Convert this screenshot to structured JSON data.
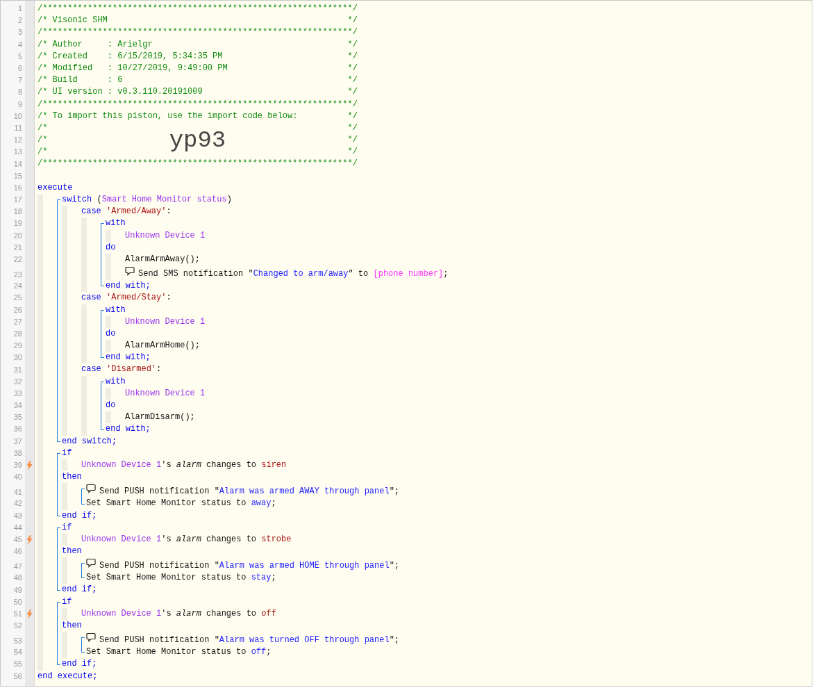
{
  "listing": [
    {
      "kind": "line",
      "number": "1",
      "tokens": [
        {
          "kind": "comment",
          "text": "/**************************************************************/"
        }
      ]
    },
    {
      "kind": "box",
      "number": "2",
      "tokens": [
        {
          "kind": "comment",
          "text": "/* Visonic SHM"
        },
        {
          "kind": "comment",
          "text": "*/"
        }
      ]
    },
    {
      "kind": "line",
      "number": "3",
      "tokens": [
        {
          "kind": "comment",
          "text": "/**************************************************************/"
        }
      ]
    },
    {
      "kind": "box",
      "number": "4",
      "tokens": [
        {
          "kind": "comment",
          "text": "/* Author     : Arielgr"
        },
        {
          "kind": "comment",
          "text": "*/"
        }
      ]
    },
    {
      "kind": "box",
      "number": "5",
      "tokens": [
        {
          "kind": "comment",
          "text": "/* Created    : 6/15/2019, 5:34:35 PM"
        },
        {
          "kind": "comment",
          "text": "*/"
        }
      ]
    },
    {
      "kind": "box",
      "number": "6",
      "tokens": [
        {
          "kind": "comment",
          "text": "/* Modified   : 10/27/2019, 9:49:00 PM"
        },
        {
          "kind": "comment",
          "text": "*/"
        }
      ]
    },
    {
      "kind": "box",
      "number": "7",
      "tokens": [
        {
          "kind": "comment",
          "text": "/* Build      : 6"
        },
        {
          "kind": "comment",
          "text": "*/"
        }
      ]
    },
    {
      "kind": "box",
      "number": "8",
      "tokens": [
        {
          "kind": "comment",
          "text": "/* UI version : v0.3.110.20191009"
        },
        {
          "kind": "comment",
          "text": "*/"
        }
      ]
    },
    {
      "kind": "line",
      "number": "9",
      "tokens": [
        {
          "kind": "comment",
          "text": "/**************************************************************/"
        }
      ]
    },
    {
      "kind": "box",
      "number": "10",
      "tokens": [
        {
          "kind": "comment",
          "text": "/* To import this piston, use the import code below:"
        },
        {
          "kind": "comment",
          "text": "*/"
        }
      ]
    },
    {
      "kind": "box",
      "number": "11",
      "tokens": [
        {
          "kind": "comment",
          "text": "/*"
        },
        {
          "kind": "comment",
          "text": "*/"
        }
      ]
    },
    {
      "kind": "box",
      "number": "12",
      "tokens": [
        {
          "kind": "comment",
          "text": "/*"
        },
        {
          "kind": "big",
          "text": "yp93"
        },
        {
          "kind": "comment",
          "text": "*/"
        }
      ]
    },
    {
      "kind": "box",
      "number": "13",
      "tokens": [
        {
          "kind": "comment",
          "text": "/*"
        },
        {
          "kind": "comment",
          "text": "*/"
        }
      ]
    },
    {
      "kind": "line",
      "number": "14",
      "tokens": [
        {
          "kind": "comment",
          "text": "/**************************************************************/"
        }
      ]
    },
    {
      "kind": "line",
      "number": "15"
    },
    {
      "kind": "line",
      "number": "16",
      "tokens": [
        {
          "kind": "kw",
          "text": "execute"
        }
      ],
      "children": [
        {
          "kind": "statement",
          "lines": [
            {
              "kind": "line",
              "number": "17",
              "tokens": [
                {
                  "kind": "kw",
                  "text": "switch"
                },
                {
                  "kind": "text",
                  "text": " ("
                },
                {
                  "kind": "dev",
                  "text": "Smart Home Monitor status"
                },
                {
                  "kind": "text",
                  "text": ")"
                }
              ],
              "children": [
                {
                  "kind": "line",
                  "number": "18",
                  "tokens": [
                    {
                      "kind": "kw",
                      "text": "case "
                    },
                    {
                      "kind": "str",
                      "text": "'Armed/Away'"
                    },
                    {
                      "kind": "text",
                      "text": ":"
                    }
                  ],
                  "children": [
                    {
                      "kind": "statement",
                      "lines": [
                        {
                          "kind": "line",
                          "number": "19",
                          "tokens": [
                            {
                              "kind": "kw",
                              "text": "with"
                            }
                          ],
                          "children": [
                            {
                              "kind": "line",
                              "number": "20",
                              "tokens": [
                                {
                                  "kind": "dev",
                                  "text": "Unknown Device 1"
                                }
                              ]
                            }
                          ]
                        },
                        {
                          "kind": "line",
                          "number": "21",
                          "tokens": [
                            {
                              "kind": "kw",
                              "text": "do"
                            }
                          ],
                          "children": [
                            {
                              "kind": "line",
                              "number": "22",
                              "tokens": [
                                {
                                  "kind": "text",
                                  "text": "AlarmArmAway();"
                                }
                              ]
                            },
                            {
                              "kind": "notice",
                              "number": "23",
                              "tokens": [
                                {
                                  "kind": "text",
                                  "text": "Send SMS notification \""
                                },
                                {
                                  "kind": "val",
                                  "text": "Changed to arm/away"
                                },
                                {
                                  "kind": "text",
                                  "text": "\" to "
                                },
                                {
                                  "kind": "var",
                                  "text": "[phone number]"
                                },
                                {
                                  "kind": "text",
                                  "text": ";"
                                }
                              ]
                            }
                          ]
                        },
                        {
                          "kind": "line",
                          "number": "24",
                          "tokens": [
                            {
                              "kind": "kw",
                              "text": "end with;"
                            }
                          ]
                        }
                      ]
                    }
                  ]
                },
                {
                  "kind": "line",
                  "number": "25",
                  "tokens": [
                    {
                      "kind": "kw",
                      "text": "case "
                    },
                    {
                      "kind": "str",
                      "text": "'Armed/Stay'"
                    },
                    {
                      "kind": "text",
                      "text": ":"
                    }
                  ],
                  "children": [
                    {
                      "kind": "statement",
                      "lines": [
                        {
                          "kind": "line",
                          "number": "26",
                          "tokens": [
                            {
                              "kind": "kw",
                              "text": "with"
                            }
                          ],
                          "children": [
                            {
                              "kind": "line",
                              "number": "27",
                              "tokens": [
                                {
                                  "kind": "dev",
                                  "text": "Unknown Device 1"
                                }
                              ]
                            }
                          ]
                        },
                        {
                          "kind": "line",
                          "number": "28",
                          "tokens": [
                            {
                              "kind": "kw",
                              "text": "do"
                            }
                          ],
                          "children": [
                            {
                              "kind": "line",
                              "number": "29",
                              "tokens": [
                                {
                                  "kind": "text",
                                  "text": "AlarmArmHome();"
                                }
                              ]
                            }
                          ]
                        },
                        {
                          "kind": "line",
                          "number": "30",
                          "tokens": [
                            {
                              "kind": "kw",
                              "text": "end with;"
                            }
                          ]
                        }
                      ]
                    }
                  ]
                },
                {
                  "kind": "line",
                  "number": "31",
                  "tokens": [
                    {
                      "kind": "kw",
                      "text": "case "
                    },
                    {
                      "kind": "str",
                      "text": "'Disarmed'"
                    },
                    {
                      "kind": "text",
                      "text": ":"
                    }
                  ],
                  "children": [
                    {
                      "kind": "statement",
                      "lines": [
                        {
                          "kind": "line",
                          "number": "32",
                          "tokens": [
                            {
                              "kind": "kw",
                              "text": "with"
                            }
                          ],
                          "children": [
                            {
                              "kind": "line",
                              "number": "33",
                              "tokens": [
                                {
                                  "kind": "dev",
                                  "text": "Unknown Device 1"
                                }
                              ]
                            }
                          ]
                        },
                        {
                          "kind": "line",
                          "number": "34",
                          "tokens": [
                            {
                              "kind": "kw",
                              "text": "do"
                            }
                          ],
                          "children": [
                            {
                              "kind": "line",
                              "number": "35",
                              "tokens": [
                                {
                                  "kind": "text",
                                  "text": "AlarmDisarm();"
                                }
                              ]
                            }
                          ]
                        },
                        {
                          "kind": "line",
                          "number": "36",
                          "tokens": [
                            {
                              "kind": "kw",
                              "text": "end with;"
                            }
                          ]
                        }
                      ]
                    }
                  ]
                }
              ]
            },
            {
              "kind": "line",
              "number": "37",
              "tokens": [
                {
                  "kind": "kw",
                  "text": "end switch;"
                }
              ]
            }
          ]
        },
        {
          "kind": "statement",
          "lines": [
            {
              "kind": "line",
              "number": "38",
              "tokens": [
                {
                  "kind": "kw",
                  "text": "if"
                }
              ],
              "children": [
                {
                  "kind": "trigger",
                  "number": "39",
                  "tokens": [
                    {
                      "kind": "dev",
                      "text": "Unknown Device 1"
                    },
                    {
                      "kind": "text",
                      "text": "'s "
                    },
                    {
                      "kind": "attr",
                      "text": "alarm"
                    },
                    {
                      "kind": "text",
                      "text": " changes to "
                    },
                    {
                      "kind": "str",
                      "text": "siren"
                    }
                  ]
                }
              ]
            },
            {
              "kind": "line",
              "number": "40",
              "tokens": [
                {
                  "kind": "kw",
                  "text": "then"
                }
              ],
              "children": [
                {
                  "kind": "statement",
                  "lines": [
                    {
                      "kind": "notice",
                      "number": "41",
                      "tokens": [
                        {
                          "kind": "text",
                          "text": "Send PUSH notification \""
                        },
                        {
                          "kind": "val",
                          "text": "Alarm was armed AWAY through panel"
                        },
                        {
                          "kind": "text",
                          "text": "\";"
                        }
                      ]
                    },
                    {
                      "kind": "line",
                      "number": "42",
                      "tokens": [
                        {
                          "kind": "text",
                          "text": "Set Smart Home Monitor status to "
                        },
                        {
                          "kind": "val",
                          "text": "away"
                        },
                        {
                          "kind": "text",
                          "text": ";"
                        }
                      ]
                    }
                  ]
                }
              ]
            },
            {
              "kind": "line",
              "number": "43",
              "tokens": [
                {
                  "kind": "kw",
                  "text": "end if;"
                }
              ]
            }
          ]
        },
        {
          "kind": "statement",
          "lines": [
            {
              "kind": "line",
              "number": "44",
              "tokens": [
                {
                  "kind": "kw",
                  "text": "if"
                }
              ],
              "children": [
                {
                  "kind": "trigger",
                  "number": "45",
                  "tokens": [
                    {
                      "kind": "dev",
                      "text": "Unknown Device 1"
                    },
                    {
                      "kind": "text",
                      "text": "'s "
                    },
                    {
                      "kind": "attr",
                      "text": "alarm"
                    },
                    {
                      "kind": "text",
                      "text": " changes to "
                    },
                    {
                      "kind": "str",
                      "text": "strobe"
                    }
                  ]
                }
              ]
            },
            {
              "kind": "line",
              "number": "46",
              "tokens": [
                {
                  "kind": "kw",
                  "text": "then"
                }
              ],
              "children": [
                {
                  "kind": "statement",
                  "lines": [
                    {
                      "kind": "notice",
                      "number": "47",
                      "tokens": [
                        {
                          "kind": "text",
                          "text": "Send PUSH notification \""
                        },
                        {
                          "kind": "val",
                          "text": "Alarm was armed HOME through panel"
                        },
                        {
                          "kind": "text",
                          "text": "\";"
                        }
                      ]
                    },
                    {
                      "kind": "line",
                      "number": "48",
                      "tokens": [
                        {
                          "kind": "text",
                          "text": "Set Smart Home Monitor status to "
                        },
                        {
                          "kind": "val",
                          "text": "stay"
                        },
                        {
                          "kind": "text",
                          "text": ";"
                        }
                      ]
                    }
                  ]
                }
              ]
            },
            {
              "kind": "line",
              "number": "49",
              "tokens": [
                {
                  "kind": "kw",
                  "text": "end if;"
                }
              ]
            }
          ]
        },
        {
          "kind": "statement",
          "lines": [
            {
              "kind": "line",
              "number": "50",
              "tokens": [
                {
                  "kind": "kw",
                  "text": "if"
                }
              ],
              "children": [
                {
                  "kind": "trigger",
                  "number": "51",
                  "tokens": [
                    {
                      "kind": "dev",
                      "text": "Unknown Device 1"
                    },
                    {
                      "kind": "text",
                      "text": "'s "
                    },
                    {
                      "kind": "attr",
                      "text": "alarm"
                    },
                    {
                      "kind": "text",
                      "text": " changes to "
                    },
                    {
                      "kind": "str",
                      "text": "off"
                    }
                  ]
                }
              ]
            },
            {
              "kind": "line",
              "number": "52",
              "tokens": [
                {
                  "kind": "kw",
                  "text": "then"
                }
              ],
              "children": [
                {
                  "kind": "statement",
                  "lines": [
                    {
                      "kind": "notice",
                      "number": "53",
                      "tokens": [
                        {
                          "kind": "text",
                          "text": "Send PUSH notification \""
                        },
                        {
                          "kind": "val",
                          "text": "Alarm was turned OFF through panel"
                        },
                        {
                          "kind": "text",
                          "text": "\";"
                        }
                      ]
                    },
                    {
                      "kind": "line",
                      "number": "54",
                      "tokens": [
                        {
                          "kind": "text",
                          "text": "Set Smart Home Monitor status to "
                        },
                        {
                          "kind": "val",
                          "text": "off"
                        },
                        {
                          "kind": "text",
                          "text": ";"
                        }
                      ]
                    }
                  ]
                }
              ]
            },
            {
              "kind": "line",
              "number": "55",
              "tokens": [
                {
                  "kind": "kw",
                  "text": "end if;"
                }
              ]
            }
          ]
        }
      ]
    },
    {
      "kind": "line",
      "number": "56",
      "tokens": [
        {
          "kind": "kw",
          "text": "end execute;"
        }
      ]
    }
  ]
}
